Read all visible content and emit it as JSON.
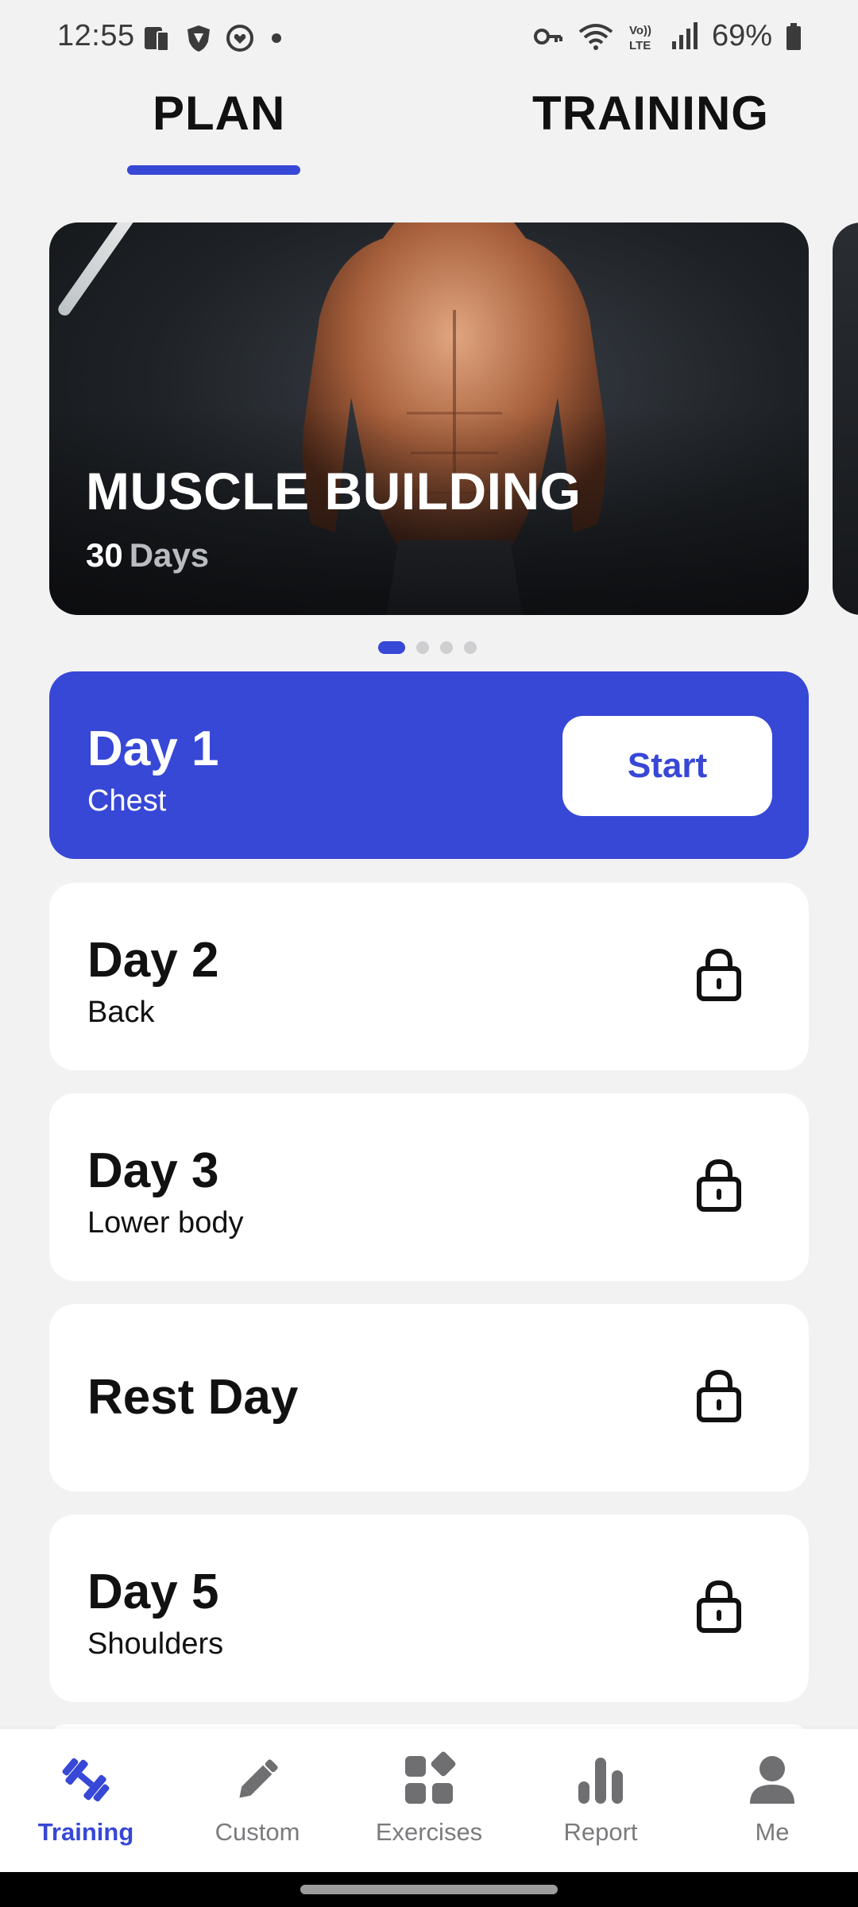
{
  "status_bar": {
    "time": "12:55",
    "battery": "69%",
    "icons_left": [
      "phone-tablet-icon",
      "shield-icon",
      "heart-face-icon",
      "dot-icon"
    ],
    "icons_right": [
      "vpn-key-icon",
      "wifi-icon",
      "volte-icon",
      "signal-icon",
      "battery-icon"
    ]
  },
  "tabs": [
    {
      "label": "PLAN",
      "active": true
    },
    {
      "label": "TRAINING",
      "active": false
    }
  ],
  "hero": {
    "title": "MUSCLE BUILDING",
    "days_number": "30",
    "days_unit": "Days"
  },
  "pager": {
    "count": 4,
    "active": 0
  },
  "days": [
    {
      "title": "Day 1",
      "subtitle": "Chest",
      "state": "current",
      "button": "Start"
    },
    {
      "title": "Day 2",
      "subtitle": "Back",
      "state": "locked"
    },
    {
      "title": "Day 3",
      "subtitle": "Lower body",
      "state": "locked"
    },
    {
      "title": "Rest Day",
      "subtitle": "",
      "state": "locked"
    },
    {
      "title": "Day 5",
      "subtitle": "Shoulders",
      "state": "locked"
    }
  ],
  "bottom_nav": [
    {
      "label": "Training",
      "icon": "dumbbell-icon",
      "active": true
    },
    {
      "label": "Custom",
      "icon": "pencil-icon",
      "active": false
    },
    {
      "label": "Exercises",
      "icon": "grid-icon",
      "active": false
    },
    {
      "label": "Report",
      "icon": "bar-chart-icon",
      "active": false
    },
    {
      "label": "Me",
      "icon": "person-icon",
      "active": false
    }
  ],
  "colors": {
    "accent": "#3747d6",
    "background": "#f2f2f2",
    "card": "#ffffff"
  }
}
